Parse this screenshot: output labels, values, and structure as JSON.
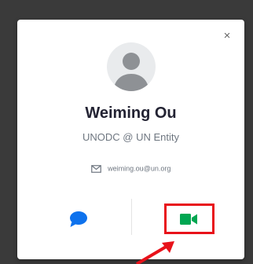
{
  "profile": {
    "name": "Weiming Ou",
    "organization": "UNODC @ UN Entity",
    "email": "weiming.ou@un.org"
  },
  "icons": {
    "close": "close-icon",
    "avatar": "person-placeholder-icon",
    "mail": "mail-icon",
    "chat": "chat-bubble-icon",
    "video": "video-camera-icon"
  },
  "colors": {
    "chat_icon": "#0e72ed",
    "video_icon": "#00a651",
    "highlight_box": "#e8121a",
    "arrow": "#e8121a"
  },
  "close_glyph": "×"
}
